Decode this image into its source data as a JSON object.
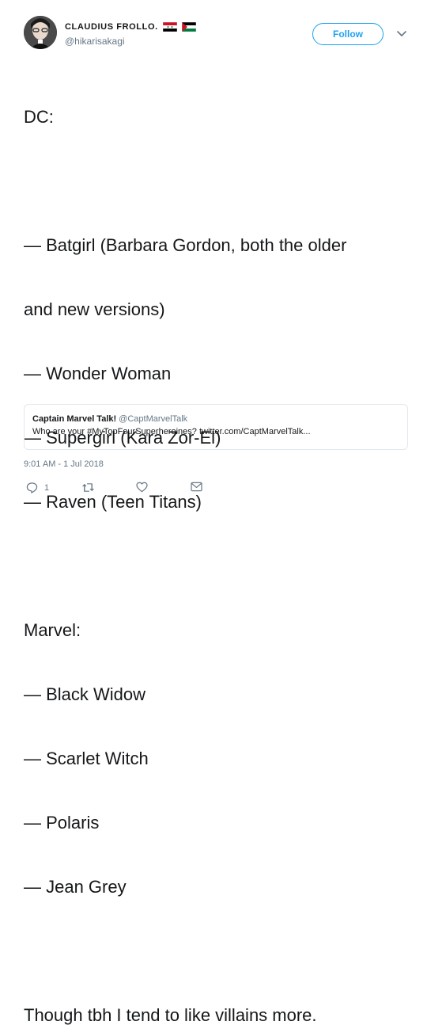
{
  "user": {
    "display_name": "CLAUDIUS FROLLO.",
    "handle": "@hikarisakagi",
    "avatar_icon": "avatar-photo-icon",
    "flags": [
      "syria-flag-icon",
      "palestine-flag-icon"
    ]
  },
  "follow_button": {
    "label": "Follow"
  },
  "tweet": {
    "lines": [
      "DC:",
      "",
      "— Batgirl (Barbara Gordon, both the older",
      "and new versions)",
      "— Wonder Woman",
      "— Supergirl (Kara Zor-El)",
      "— Raven (Teen Titans)",
      "",
      "Marvel:",
      "— Black Widow",
      "— Scarlet Witch",
      "— Polaris",
      "— Jean Grey",
      "",
      "Though tbh I tend to like villains more."
    ]
  },
  "quote": {
    "name": "Captain Marvel Talk!",
    "handle": "@CaptMarvelTalk",
    "text": "Who are your #MyTopFourSuperheroines? twitter.com/CaptMarvelTalk..."
  },
  "timestamp": "9:01 AM - 1 Jul 2018",
  "actions": {
    "reply_count": "1",
    "icons": [
      "reply-icon",
      "retweet-icon",
      "like-icon",
      "message-icon"
    ]
  },
  "colors": {
    "accent": "#1da1f2",
    "text": "#14171a",
    "muted": "#657786",
    "border": "#e1e8ed"
  }
}
